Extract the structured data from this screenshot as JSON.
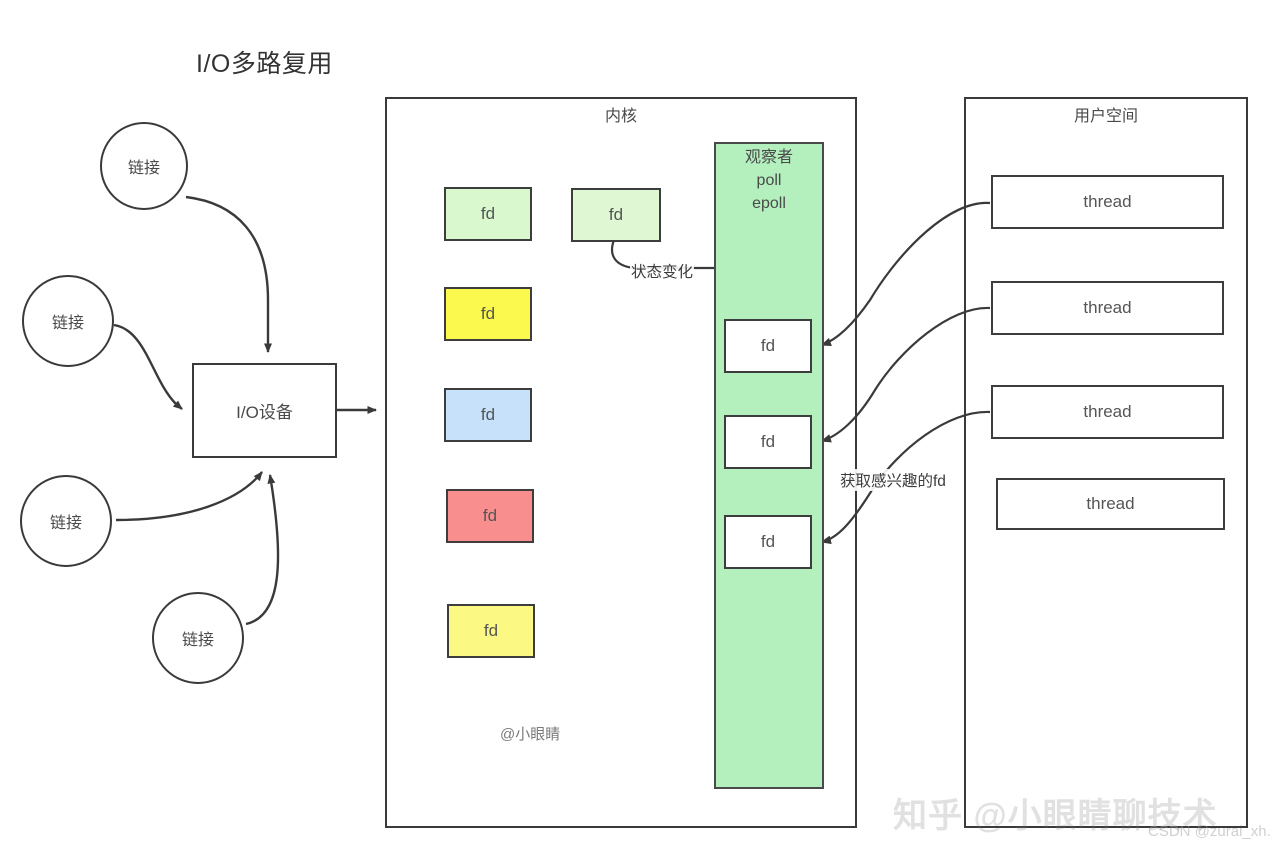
{
  "title": "I/O多路复用",
  "connections": [
    {
      "label": "链接"
    },
    {
      "label": "链接"
    },
    {
      "label": "链接"
    },
    {
      "label": "链接"
    }
  ],
  "io_device": {
    "label": "I/O设备"
  },
  "kernel": {
    "label": "内核",
    "fd_boxes": [
      {
        "label": "fd",
        "color": "#d9f8cd"
      },
      {
        "label": "fd",
        "color": "#fbf84e"
      },
      {
        "label": "fd",
        "color": "#c7e1fb"
      },
      {
        "label": "fd",
        "color": "#f88e8e"
      },
      {
        "label": "fd",
        "color": "#fbf883"
      }
    ],
    "changed_fd": {
      "label": "fd",
      "color": "#dff7d3"
    }
  },
  "observer": {
    "title": "观察者",
    "api_poll": "poll",
    "api_epoll": "epoll",
    "color": "#b3f0bd",
    "fd_boxes": [
      {
        "label": "fd"
      },
      {
        "label": "fd"
      },
      {
        "label": "fd"
      }
    ]
  },
  "user_space": {
    "label": "用户空间",
    "threads": [
      {
        "label": "thread"
      },
      {
        "label": "thread"
      },
      {
        "label": "thread"
      },
      {
        "label": "thread"
      }
    ]
  },
  "edge_labels": {
    "state_change": "状态变化",
    "fetch_fd": "获取感兴趣的fd"
  },
  "watermarks": {
    "author_tag": "@小眼睛",
    "zhihu": "知乎 @小眼睛聊技术",
    "csdn": "CSDN @zurai_xh."
  },
  "colors": {
    "stroke": "#3a3a3a",
    "text": "#4a4a4a",
    "observer_fill": "#b3f0bd"
  }
}
